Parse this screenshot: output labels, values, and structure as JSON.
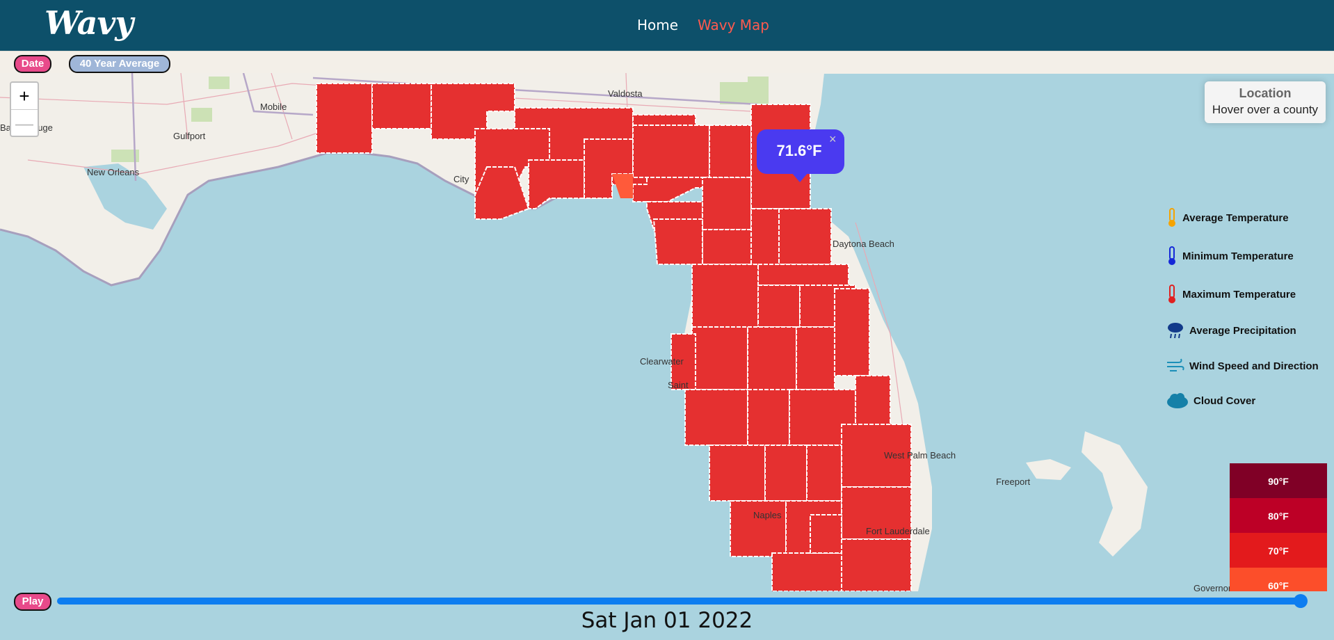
{
  "header": {
    "logo": "Wavy",
    "nav": [
      {
        "label": "Home",
        "color": "#ffffff"
      },
      {
        "label": "Wavy Map",
        "color": "#ff5a4f"
      }
    ]
  },
  "toggles": {
    "date_label": "Date",
    "date_color": "#e84a8a",
    "average_label": "40 Year Average",
    "average_color": "#9fb6d8"
  },
  "map": {
    "zoom_in": "+",
    "zoom_out": "—",
    "places": [
      "Valdosta",
      "Mobile",
      "Gulfport",
      "New Orleans",
      "Baton Rouge",
      "City",
      "Daytona Beach",
      "Clearwater",
      "Saint",
      "Naples",
      "Fort Lauderdale",
      "Freeport",
      "Governor's",
      "West Palm Beach"
    ],
    "fill_color": "#e53030",
    "highlight_color": "#ff5a3a"
  },
  "location_box": {
    "title": "Location",
    "hint": "Hover over a county"
  },
  "popup": {
    "value": "71.6°F",
    "close": "×"
  },
  "layers": [
    {
      "label": "Average Temperature",
      "icon": "thermometer-orange-icon",
      "color": "#f5a300"
    },
    {
      "label": "Minimum Temperature",
      "icon": "thermometer-blue-icon",
      "color": "#1428d8"
    },
    {
      "label": "Maximum Temperature",
      "icon": "thermometer-red-icon",
      "color": "#e02020"
    },
    {
      "label": "Average Precipitation",
      "icon": "rain-cloud-icon",
      "color": "#123a8a"
    },
    {
      "label": "Wind Speed and Direction",
      "icon": "wind-icon",
      "color": "#1b8fb8"
    },
    {
      "label": "Cloud Cover",
      "icon": "cloud-icon",
      "color": "#1580a8"
    }
  ],
  "legend": [
    {
      "label": "90°F",
      "color": "#800026"
    },
    {
      "label": "80°F",
      "color": "#bd0026"
    },
    {
      "label": "70°F",
      "color": "#e31a1c"
    },
    {
      "label": "60°F",
      "color": "#fc4e2a"
    }
  ],
  "timeline": {
    "play_label": "Play",
    "date": "Sat Jan 01 2022",
    "progress": 1.0
  }
}
